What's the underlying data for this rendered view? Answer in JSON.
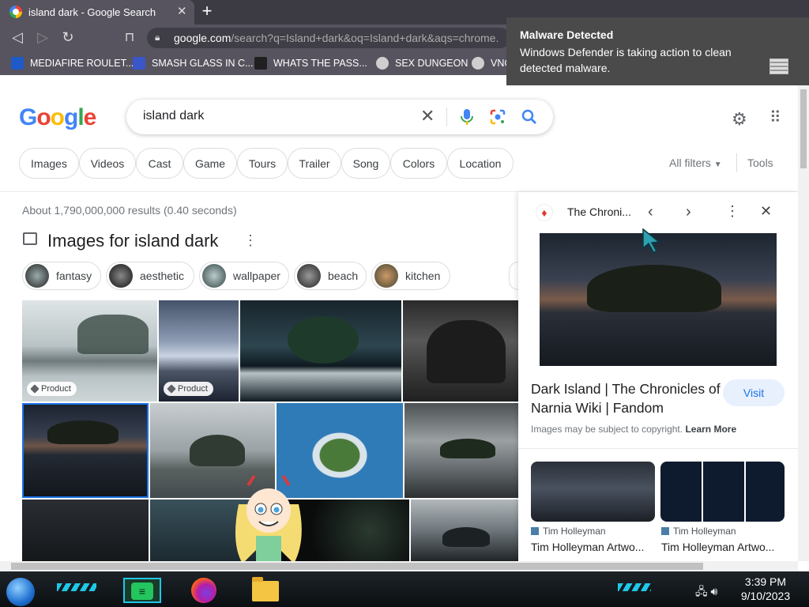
{
  "browser": {
    "tab_title": "island dark - Google Search",
    "url_host": "google.com",
    "url_path": "/search?q=Island+dark&oq=Island+dark&aqs=chrome.",
    "bookmarks": [
      {
        "label": "MEDIAFIRE ROULET...",
        "icon": "mediafire-icon",
        "color": "#1e5ac8"
      },
      {
        "label": "SMASH GLASS IN C...",
        "icon": "sigma-icon",
        "color": "#3a56c8"
      },
      {
        "label": "WHATS THE PASS...",
        "icon": "mask-icon",
        "color": "#202020"
      },
      {
        "label": "SEX DUNGEON",
        "icon": "vnc-icon",
        "color": "#cfcfcf"
      },
      {
        "label": "VNC",
        "icon": "vnc-icon",
        "color": "#cfcfcf"
      }
    ]
  },
  "notification": {
    "title": "Malware Detected",
    "body": "Windows Defender is taking action to clean detected malware."
  },
  "google": {
    "logo": "Google",
    "query": "island dark",
    "chips": [
      "Images",
      "Videos",
      "Cast",
      "Game",
      "Tours",
      "Trailer",
      "Song",
      "Colors",
      "Location"
    ],
    "all_filters": "All filters",
    "tools": "Tools",
    "stats": "About 1,790,000,000 results (0.40 seconds)",
    "images_heading": "Images for island dark",
    "refine": [
      "fantasy",
      "aesthetic",
      "wallpaper",
      "beach",
      "kitchen"
    ],
    "badge": "Product"
  },
  "panel": {
    "source": "The Chroni...",
    "headline": "Dark Island | The Chronicles of Narnia Wiki | Fandom",
    "visit": "Visit",
    "copyright": "Images may be subject to copyright.",
    "learn_more": "Learn More",
    "related": [
      {
        "source": "Tim Holleyman",
        "title": "Tim Holleyman Artwo..."
      },
      {
        "source": "Tim Holleyman",
        "title": "Tim Holleyman Artwo..."
      }
    ]
  },
  "taskbar": {
    "time": "3:39 PM",
    "date": "9/10/2023"
  }
}
